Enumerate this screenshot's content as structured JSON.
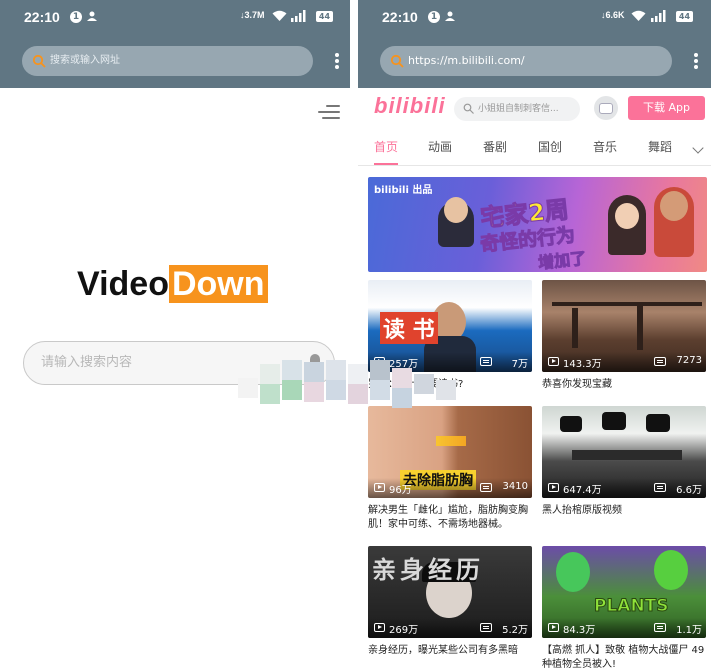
{
  "left": {
    "status": {
      "time": "22:10",
      "notif_count": "1",
      "net_speed": "↓3.7M",
      "battery": "44"
    },
    "browser": {
      "url_placeholder": "搜索或输入网址"
    },
    "app": {
      "logo_part1": "Video",
      "logo_part2": "Down",
      "search_placeholder": "请输入搜索内容"
    }
  },
  "right": {
    "status": {
      "time": "22:10",
      "notif_count": "1",
      "net_speed": "↓6.6K",
      "battery": "44"
    },
    "browser": {
      "url": "https://m.bilibili.com/"
    },
    "header": {
      "logo": "bilibili",
      "search_placeholder": "小姐姐自制刺客信...",
      "download_button": "下载 App"
    },
    "tabs": [
      "首页",
      "动画",
      "番剧",
      "国创",
      "音乐",
      "舞蹈"
    ],
    "banner": {
      "brand": "bilibili 出品",
      "line1": "宅家2周",
      "line2": "奇怪的行为",
      "line3": "增加了"
    },
    "videos": [
      {
        "title": "罗翔：为什么要读书?",
        "views": "257万",
        "danmaku": "7万",
        "caption": "读  书"
      },
      {
        "title": "恭喜你发现宝藏",
        "views": "143.3万",
        "danmaku": "7273",
        "caption": ""
      },
      {
        "title": "解决男生「雌化」尴尬，脂肪胸变胸肌！家中可练、不需场地器械。",
        "views": "96万",
        "danmaku": "3410",
        "caption": "去除脂肪胸"
      },
      {
        "title": "黑人抬棺原版视频",
        "views": "647.4万",
        "danmaku": "6.6万",
        "caption": ""
      },
      {
        "title": "亲身经历，曝光某些公司有多黑暗",
        "views": "269万",
        "danmaku": "5.2万",
        "caption": "亲身经历"
      },
      {
        "title": "【高燃 抓人】致敬 植物大战僵尸 49种植物全员被入!",
        "views": "84.3万",
        "danmaku": "1.1万",
        "caption": "PLANTS"
      }
    ]
  },
  "colors": {
    "toolbar": "#607683",
    "accent": "#fb7299",
    "logo_orange": "#f7931d"
  }
}
